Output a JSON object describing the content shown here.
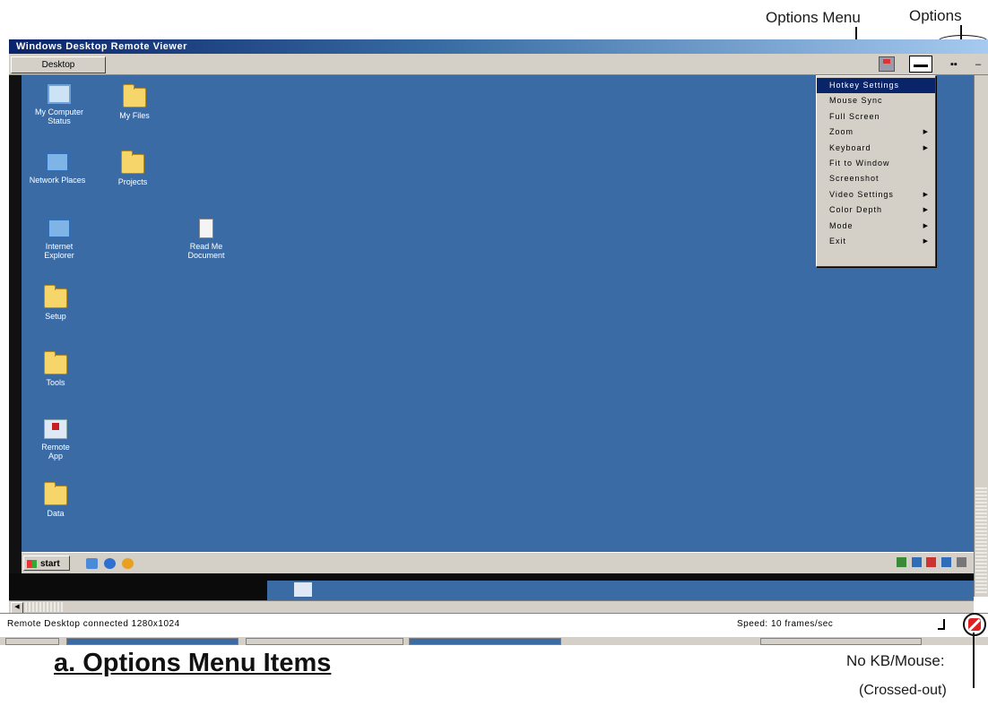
{
  "annotations": {
    "options_menu": "Options Menu",
    "options": "Options",
    "no_kb_mouse": "No KB/Mouse:",
    "crossed_out": "(Crossed-out)",
    "caption": "a. Options Menu Items"
  },
  "window": {
    "title": "Windows Desktop Remote Viewer",
    "toolbar_button": "Desktop"
  },
  "desktop_icons": [
    {
      "label": "My Computer\nStatus",
      "icon": "computer-icon"
    },
    {
      "label": "My Files",
      "icon": "folder-icon"
    },
    {
      "label": "Network Places",
      "icon": "network-icon"
    },
    {
      "label": "Projects",
      "icon": "folder-icon"
    },
    {
      "label": "Internet\nExplorer",
      "icon": "network-icon"
    },
    {
      "label": "Read Me\nDocument",
      "icon": "document-icon"
    },
    {
      "label": "Setup",
      "icon": "folder-icon"
    },
    {
      "label": "Tools",
      "icon": "folder-icon"
    },
    {
      "label": "Remote\nApp",
      "icon": "app-icon"
    },
    {
      "label": "Data",
      "icon": "folder-icon"
    }
  ],
  "options_menu_items": [
    {
      "label": "Hotkey Settings",
      "submenu": false,
      "highlighted": true
    },
    {
      "label": "Mouse Sync",
      "submenu": false
    },
    {
      "label": "Full Screen",
      "submenu": false
    },
    {
      "label": "Zoom",
      "submenu": true
    },
    {
      "label": "Keyboard",
      "submenu": true
    },
    {
      "label": "Fit to Window",
      "submenu": false
    },
    {
      "label": "Screenshot",
      "submenu": false
    },
    {
      "label": "Video Settings",
      "submenu": true
    },
    {
      "label": "Color Depth",
      "submenu": true
    },
    {
      "label": "Mode",
      "submenu": true
    },
    {
      "label": "Exit",
      "submenu": true
    }
  ],
  "remote_taskbar": {
    "start_label": "start",
    "tray_text": ""
  },
  "status": {
    "left": "Remote Desktop connected 1280x1024",
    "right": "Speed: 10 frames/sec"
  },
  "colors": {
    "desktop_blue": "#3b6ba5",
    "menu_highlight": "#0a246a",
    "window_face": "#d4d0c8"
  }
}
